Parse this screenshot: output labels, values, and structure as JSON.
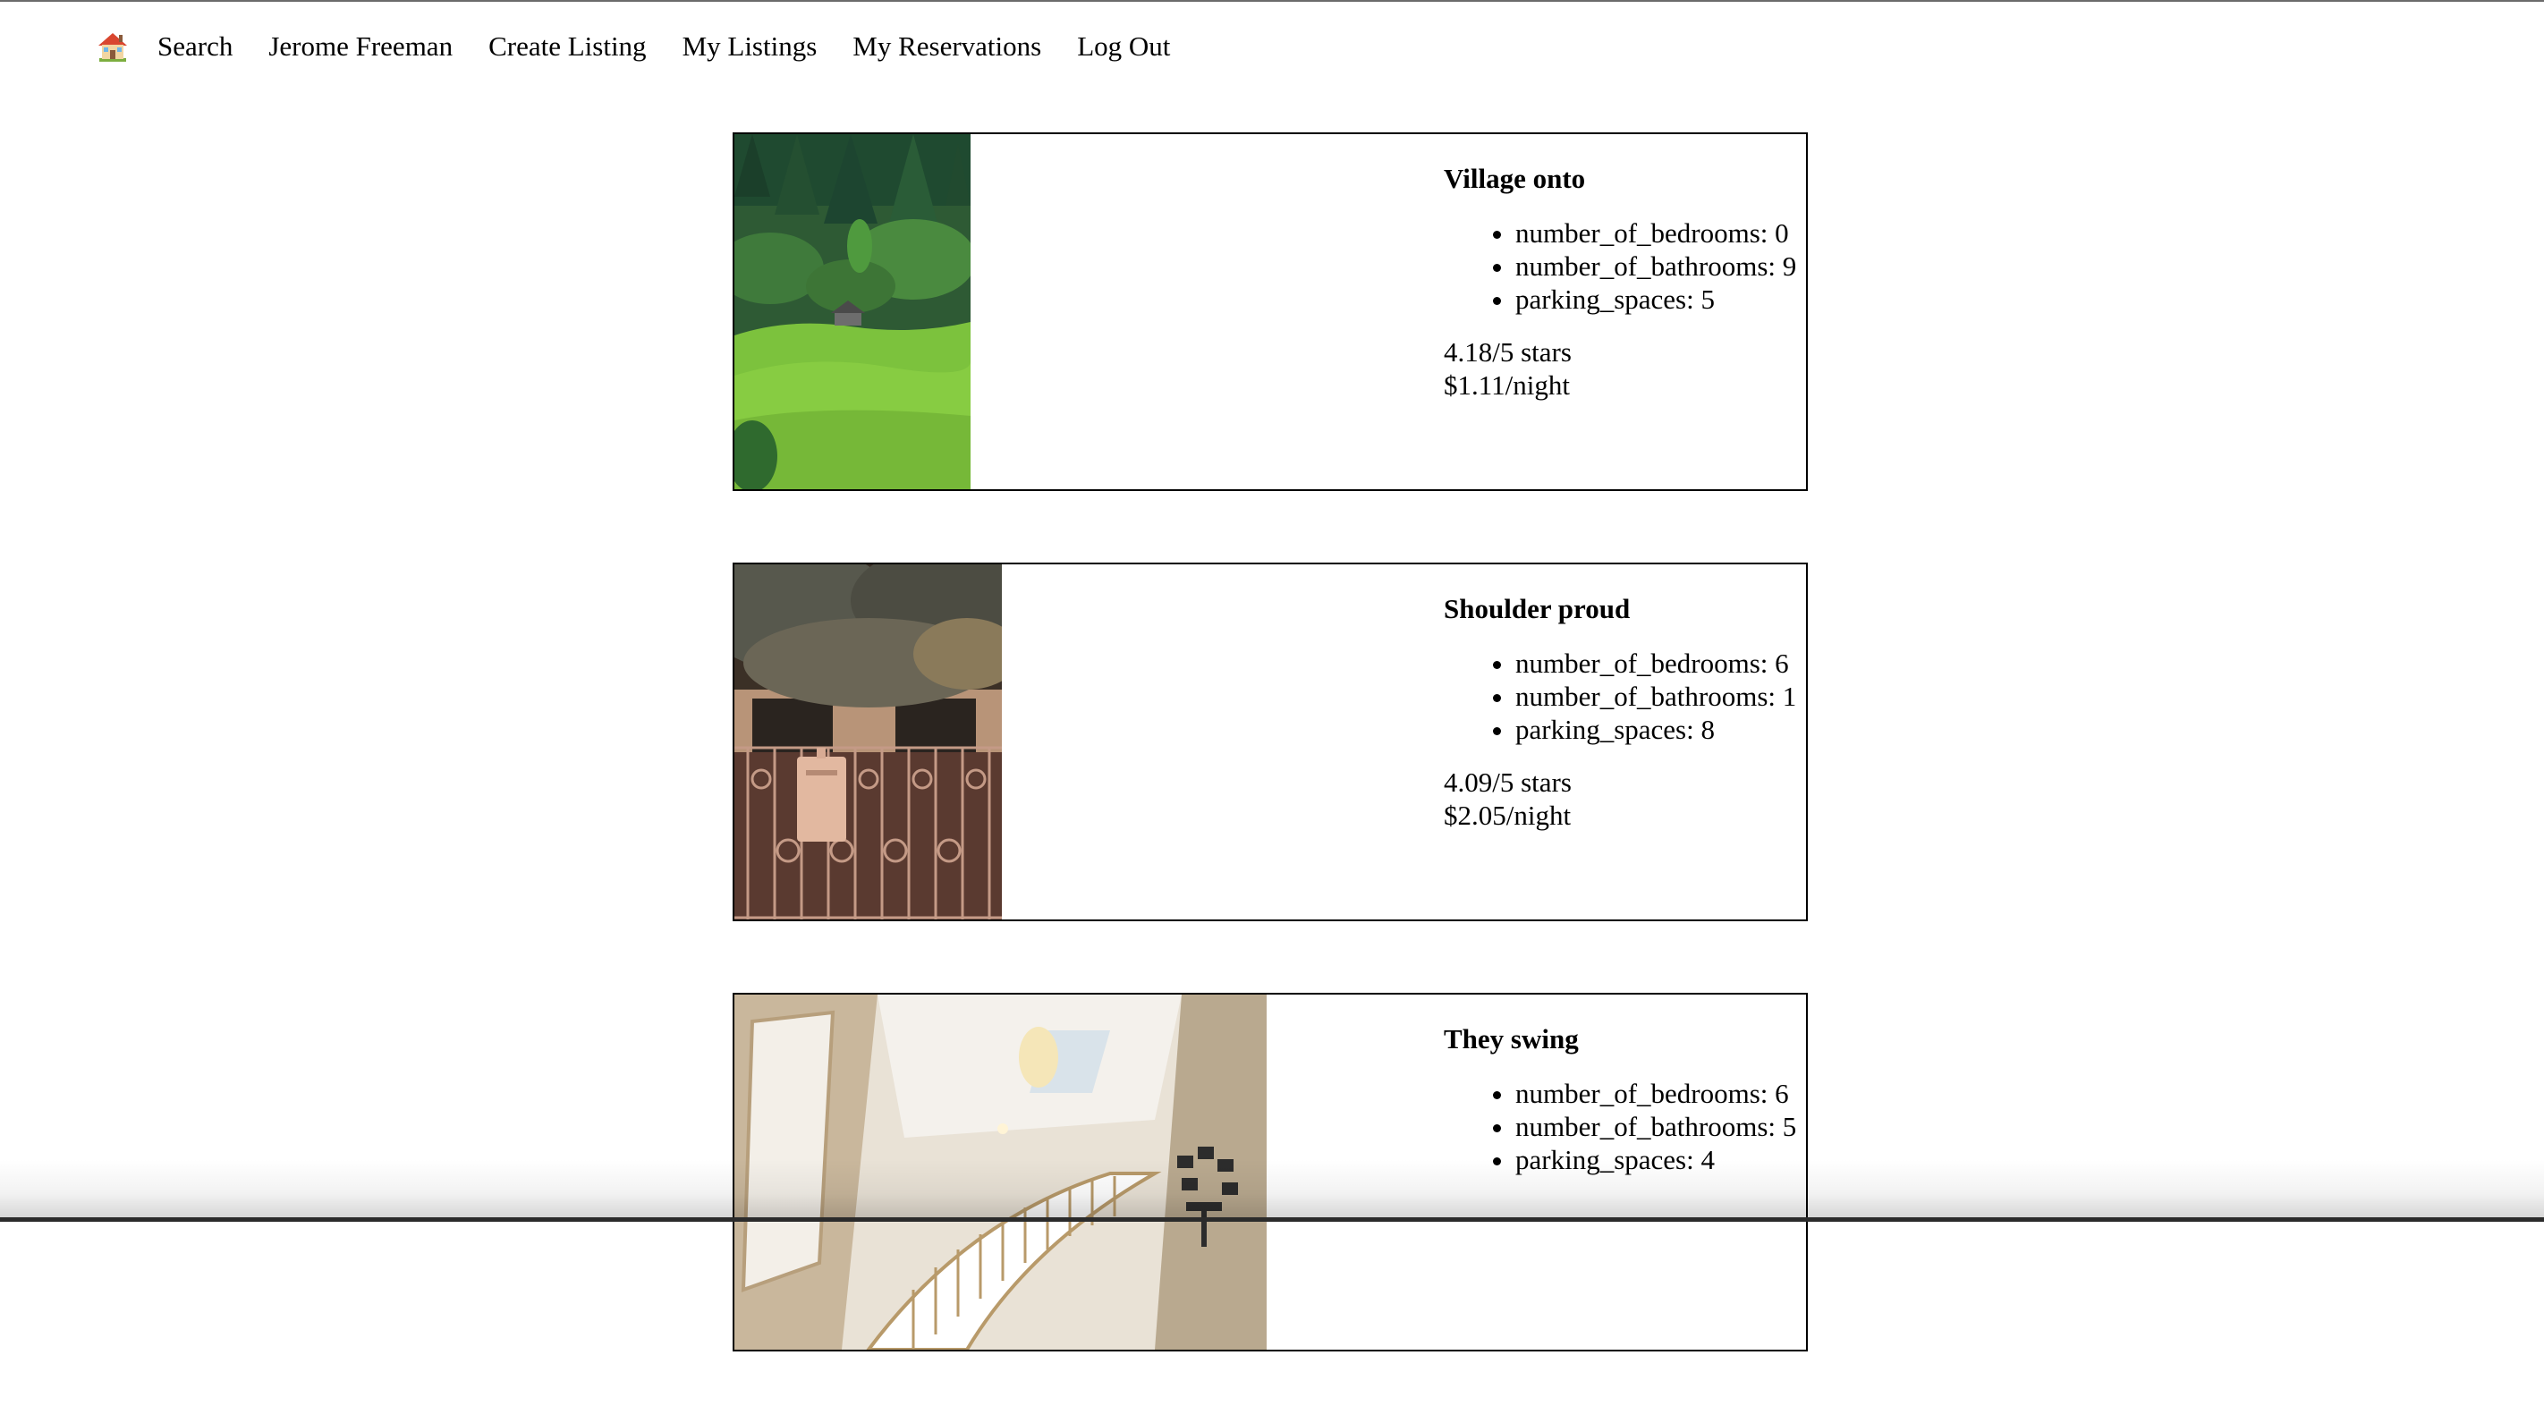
{
  "nav": {
    "home_icon": "house-icon",
    "items": [
      "Search",
      "Jerome Freeman",
      "Create Listing",
      "My Listings",
      "My Reservations",
      "Log Out"
    ]
  },
  "listings": [
    {
      "title": "Village onto",
      "features": [
        "number_of_bedrooms: 0",
        "number_of_bathrooms: 9",
        "parking_spaces: 5"
      ],
      "rating": "4.18/5 stars",
      "price": "$1.11/night"
    },
    {
      "title": "Shoulder proud",
      "features": [
        "number_of_bedrooms: 6",
        "number_of_bathrooms: 1",
        "parking_spaces: 8"
      ],
      "rating": "4.09/5 stars",
      "price": "$2.05/night"
    },
    {
      "title": "They swing",
      "features": [
        "number_of_bedrooms: 6",
        "number_of_bathrooms: 5",
        "parking_spaces: 4"
      ],
      "rating": "",
      "price": ""
    }
  ]
}
